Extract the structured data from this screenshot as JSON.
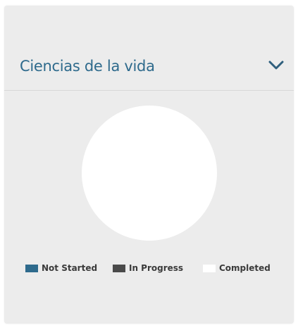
{
  "card": {
    "title": "Ciencias de la vida",
    "toggle_icon": "chevron-down-icon"
  },
  "colors": {
    "title": "#2e6a8c",
    "chevron": "#2f5f7d",
    "background": "#ececec"
  },
  "chart_data": {
    "type": "pie",
    "labels": [
      "Not Started",
      "In Progress",
      "Completed"
    ],
    "colors": [
      "#2e6a8c",
      "#4a4a4a",
      "#ffffff"
    ],
    "values": [
      0,
      0,
      1
    ],
    "legend": "bottom"
  }
}
